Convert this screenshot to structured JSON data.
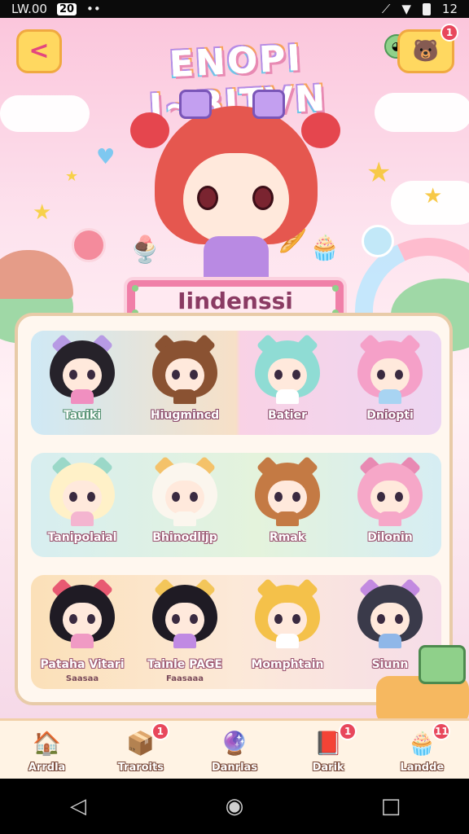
{
  "status_bar": {
    "left_text": "LW.00",
    "left_badge": "20",
    "right_time": "12"
  },
  "header": {
    "title": "ENOPI I~BITVN",
    "gift_badge": "1"
  },
  "category": {
    "label": "Iindenssi"
  },
  "grid": {
    "rows": [
      [
        {
          "label": "Tauiki",
          "hair": "#26222a",
          "body": "#f08fc0",
          "ear": "#b79ae4"
        },
        {
          "label": "Hiugmincd",
          "hair": "#8a5232",
          "body": "#8a5232",
          "ear": "#8a5232"
        },
        {
          "label": "Batier",
          "hair": "#8fdcd4",
          "body": "#ffffff",
          "ear": "#8fdcd4"
        },
        {
          "label": "Dniopti",
          "hair": "#f5a0c8",
          "body": "#a8d4f2",
          "ear": "#f5a0c8"
        }
      ],
      [
        {
          "label": "Tanipolaial",
          "hair": "#fff1c8",
          "body": "#f4b5d0",
          "ear": "#9bd8c8"
        },
        {
          "label": "Bhinodlijp",
          "hair": "#fbf6ee",
          "body": "#fbf6ee",
          "ear": "#f4c26a"
        },
        {
          "label": "Rmak",
          "hair": "#c47a44",
          "body": "#c47a44",
          "ear": "#c47a44"
        },
        {
          "label": "Dilonin",
          "hair": "#f6a7c8",
          "body": "#f6a7c8",
          "ear": "#e88ab3"
        }
      ],
      [
        {
          "label": "Pataha Vitari",
          "sub": "Saasaa",
          "hair": "#1f1b24",
          "body": "#f09ac4",
          "ear": "#e85a72"
        },
        {
          "label": "Tainle PAGE",
          "sub": "Faasaaa",
          "hair": "#1f1b24",
          "body": "#c08ae3",
          "ear": "#f3c65a"
        },
        {
          "label": "Momphtain",
          "sub": "",
          "hair": "#f4c14a",
          "body": "#ffffff",
          "ear": "#f4c14a"
        },
        {
          "label": "Siunn",
          "sub": "",
          "hair": "#3a3a4a",
          "body": "#8fb7e8",
          "ear": "#c28ae0"
        }
      ]
    ]
  },
  "bottom_nav": {
    "items": [
      {
        "label": "Arrdla",
        "icon": "house-icon",
        "glyph": "🏠",
        "badge": ""
      },
      {
        "label": "Traroits",
        "icon": "map-icon",
        "glyph": "📦",
        "badge": "1"
      },
      {
        "label": "Danrlas",
        "icon": "ball-icon",
        "glyph": "🔮",
        "badge": ""
      },
      {
        "label": "Darik",
        "icon": "book-icon",
        "glyph": "📕",
        "badge": "1"
      },
      {
        "label": "Landde",
        "icon": "cake-icon",
        "glyph": "🧁",
        "badge": "11"
      }
    ]
  },
  "colors": {
    "accent": "#f07fa8",
    "button": "#ffd860",
    "badge": "#e8475c"
  }
}
